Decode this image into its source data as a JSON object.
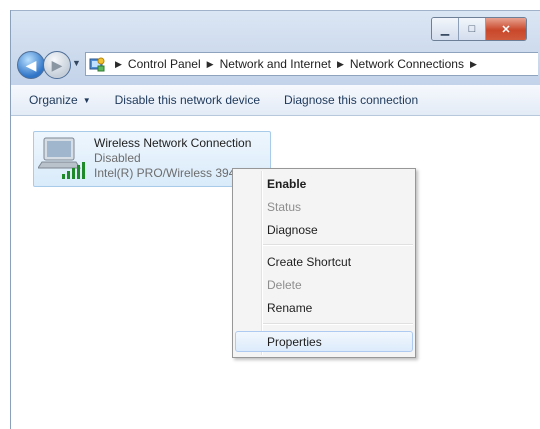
{
  "window": {
    "controls": {
      "minimize_icon": "minimize-icon",
      "maximize_icon": "maximize-icon",
      "close_icon": "close-icon"
    }
  },
  "nav": {
    "breadcrumbs": [
      "Control Panel",
      "Network and Internet",
      "Network Connections"
    ]
  },
  "toolbar": {
    "organize_label": "Organize",
    "disable_label": "Disable this network device",
    "diagnose_label": "Diagnose this connection"
  },
  "connection": {
    "name": "Wireless Network Connection",
    "status": "Disabled",
    "device": "Intel(R) PRO/Wireless 3945A..."
  },
  "context_menu": {
    "items": [
      {
        "label": "Enable",
        "state": "default"
      },
      {
        "label": "Status",
        "state": "disabled"
      },
      {
        "label": "Diagnose",
        "state": "enabled"
      },
      {
        "label": "Create Shortcut",
        "state": "enabled"
      },
      {
        "label": "Delete",
        "state": "disabled"
      },
      {
        "label": "Rename",
        "state": "enabled"
      },
      {
        "label": "Properties",
        "state": "highlighted"
      }
    ]
  },
  "colors": {
    "accent": "#2f74c7",
    "selection": "#d9ebfa",
    "close": "#c9472b"
  }
}
